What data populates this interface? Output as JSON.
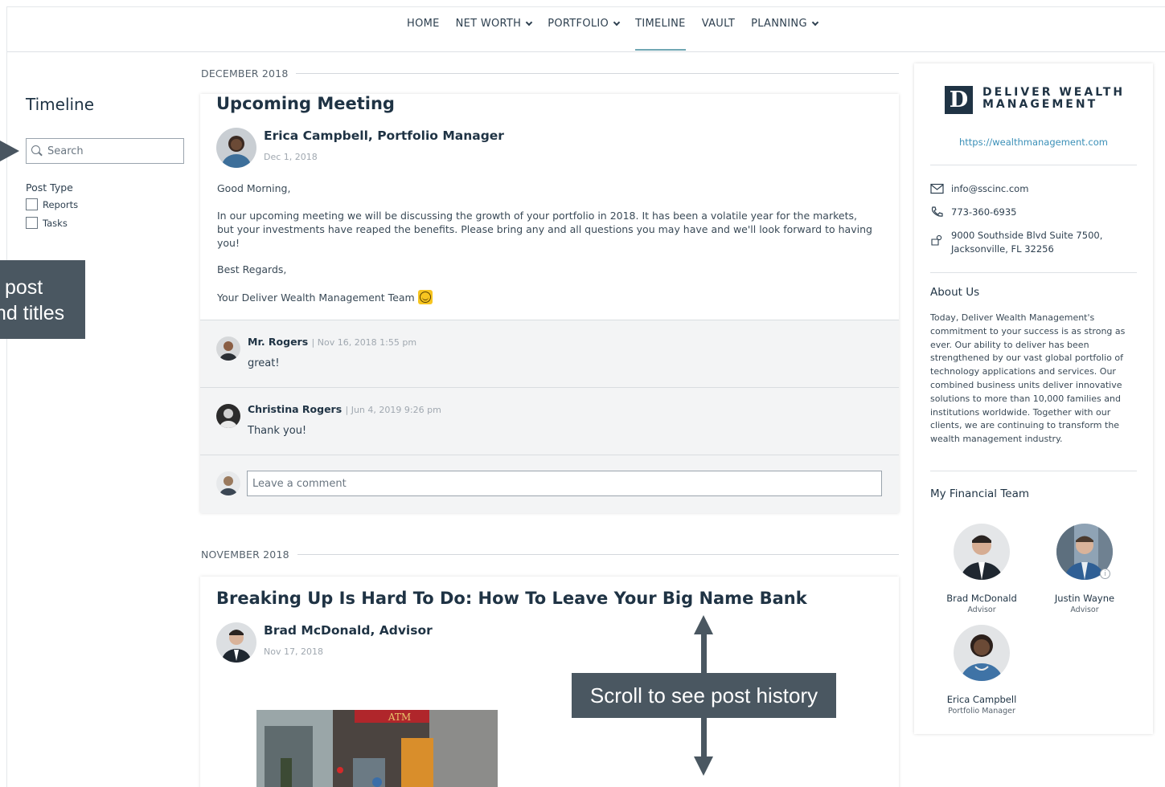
{
  "nav": {
    "items": [
      {
        "label": "HOME",
        "dropdown": false,
        "active": false
      },
      {
        "label": "NET WORTH",
        "dropdown": true,
        "active": false
      },
      {
        "label": "PORTFOLIO",
        "dropdown": true,
        "active": false
      },
      {
        "label": "TIMELINE",
        "dropdown": false,
        "active": true
      },
      {
        "label": "VAULT",
        "dropdown": false,
        "active": false
      },
      {
        "label": "PLANNING",
        "dropdown": true,
        "active": false
      }
    ]
  },
  "sidebar": {
    "title": "Timeline",
    "search_placeholder": "Search",
    "post_type_label": "Post Type",
    "filters": [
      {
        "label": "Reports",
        "checked": false
      },
      {
        "label": "Tasks",
        "checked": false
      }
    ]
  },
  "callouts": {
    "left_line1": "post",
    "left_line2": "nd titles",
    "scroll": "Scroll to see post history"
  },
  "sections": [
    {
      "month": "DECEMBER 2018",
      "post": {
        "title": "Upcoming Meeting",
        "author": "Erica Campbell, Portfolio Manager",
        "date": "Dec 1, 2018",
        "greeting": "Good Morning,",
        "paragraph": "In our upcoming meeting we will be discussing the growth of your portfolio in 2018. It has been a volatile year for the markets, but your investments have reaped the benefits. Please bring any and all questions you may have and we'll look forward to having you!",
        "closing": "Best Regards,",
        "signature": "Your Deliver Wealth Management Team",
        "comments": [
          {
            "name": "Mr. Rogers",
            "meta": "Nov 16, 2018 1:55 pm",
            "text": "great!"
          },
          {
            "name": "Christina Rogers",
            "meta": "Jun 4, 2019 9:26 pm",
            "text": "Thank you!"
          }
        ],
        "comment_placeholder": "Leave a comment"
      }
    },
    {
      "month": "NOVEMBER 2018",
      "post": {
        "title": "Breaking Up Is Hard To Do: How To Leave Your Big Name Bank",
        "author": "Brad McDonald, Advisor",
        "date": "Nov 17, 2018"
      }
    }
  ],
  "firm": {
    "logo_letter": "D",
    "name_line1": "DELIVER WEALTH",
    "name_line2": "MANAGEMENT",
    "website": "https://wealthmanagement.com",
    "email": "info@sscinc.com",
    "phone": "773-360-6935",
    "address_line1": "9000 Southside Blvd Suite 7500,",
    "address_line2": "Jacksonville, FL 32256",
    "about_heading": "About Us",
    "about_text": "Today, Deliver Wealth Management's commitment to your success is as strong as ever. Our ability to deliver has been strengthened by our vast global portfolio of technology applications and services. Our combined business units deliver innovative solutions to more than 10,000 families and institutions worldwide. Together with our clients, we are continuing to transform the wealth management industry.",
    "team_heading": "My Financial Team",
    "team": [
      {
        "name": "Brad McDonald",
        "role": "Advisor"
      },
      {
        "name": "Justin Wayne",
        "role": "Advisor"
      },
      {
        "name": "Erica Campbell",
        "role": "Portfolio Manager"
      }
    ]
  },
  "colors": {
    "accent": "#6fa7b3",
    "navy": "#1f3344",
    "link": "#3a8fb7",
    "callout": "#4a5761"
  }
}
